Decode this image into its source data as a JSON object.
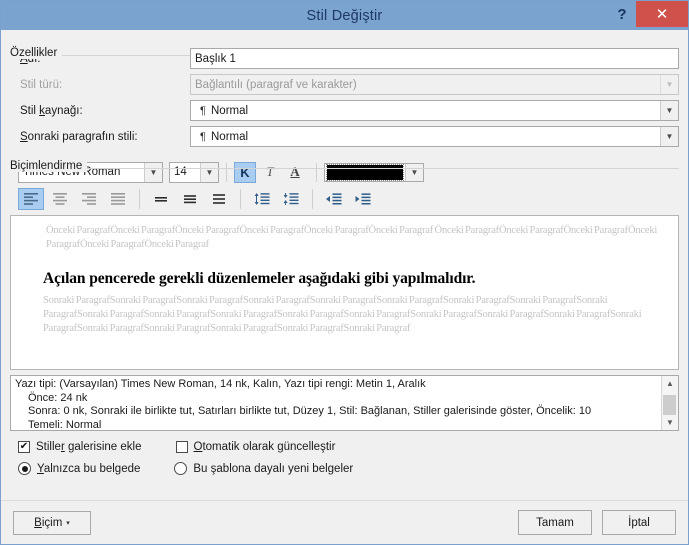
{
  "window": {
    "title": "Stil Değiştir",
    "help_label": "?",
    "close_label": "✕",
    "titlebar_color": "#7ba3d0",
    "close_color": "#d0504b"
  },
  "properties": {
    "group_label": "Özellikler",
    "name_label": "Adı:",
    "name_value": "Başlık 1",
    "style_type_label": "Stil türü:",
    "style_type_value": "Bağlantılı (paragraf ve karakter)",
    "style_type_disabled": true,
    "based_on_label": "Stil kaynağı:",
    "based_on_value": "Normal",
    "next_style_label": "Sonraki paragrafın stili:",
    "next_style_value": "Normal",
    "pilcrow": "¶"
  },
  "formatting": {
    "group_label": "Biçimlendirme",
    "font_family": "Times New Roman",
    "font_size": "14",
    "bold_label": "K",
    "italic_label": "T",
    "underline_label": "A",
    "bold_active": true,
    "font_color": "#000000",
    "align": [
      {
        "name": "align-left-icon",
        "active": true
      },
      {
        "name": "align-center-icon",
        "active": false
      },
      {
        "name": "align-right-icon",
        "active": false
      },
      {
        "name": "align-justify-icon",
        "active": false
      }
    ],
    "line_spacing": [
      {
        "name": "line-spacing-single-icon"
      },
      {
        "name": "line-spacing-one-and-half-icon"
      },
      {
        "name": "line-spacing-double-icon"
      }
    ],
    "paragraph_spacing": [
      {
        "name": "space-before-paragraph-icon"
      },
      {
        "name": "space-after-paragraph-icon"
      }
    ],
    "indent": [
      {
        "name": "decrease-indent-icon"
      },
      {
        "name": "increase-indent-icon"
      }
    ]
  },
  "preview": {
    "previous_paragraph": "Önceki ParagrafÖnceki ParagrafÖnceki ParagrafÖnceki ParagrafÖnceki ParagrafÖnceki Paragraf Önceki ParagrafÖnceki ParagrafÖnceki ParagrafÖnceki ParagrafÖnceki ParagrafÖnceki Paragraf",
    "sample_text": "Açılan pencerede gerekli düzenlemeler aşağıdaki gibi yapılmalıdır.",
    "following_paragraph": "Sonraki ParagrafSonraki ParagrafSonraki ParagrafSonraki ParagrafSonraki ParagrafSonraki ParagrafSonraki ParagrafSonraki ParagrafSonraki ParagrafSonraki ParagrafSonraki ParagrafSonraki ParagrafSonraki ParagrafSonraki ParagrafSonraki ParagrafSonraki ParagrafSonraki ParagrafSonraki ParagrafSonraki ParagrafSonraki ParagrafSonraki ParagrafSonraki ParagrafSonraki Paragraf"
  },
  "description": {
    "line1": "Yazı tipi: (Varsayılan) Times New Roman, 14 nk, Kalın, Yazı tipi rengi: Metin 1, Aralık",
    "line2": "Önce:  24 nk",
    "line3": "Sonra:  0 nk, Sonraki ile birlikte tut, Satırları birlikte tut, Düzey 1, Stil: Bağlanan, Stiller galerisinde göster, Öncelik: 10",
    "line4": "Temeli: Normal",
    "scroll_up": "⌃",
    "scroll_down": "⌄"
  },
  "options": {
    "add_to_gallery_label": "Stiller galerisine ekle",
    "add_to_gallery_checked": true,
    "auto_update_label": "Otomatik olarak güncelleştir",
    "auto_update_checked": false,
    "only_this_document_label": "Yalnızca bu belgede",
    "only_this_document_selected": true,
    "new_documents_label": "Bu şablona dayalı yeni belgeler",
    "new_documents_selected": false,
    "check_mark": "✔"
  },
  "footer": {
    "format_label": "Biçim",
    "format_caret": "▾",
    "ok_label": "Tamam",
    "cancel_label": "İptal"
  }
}
